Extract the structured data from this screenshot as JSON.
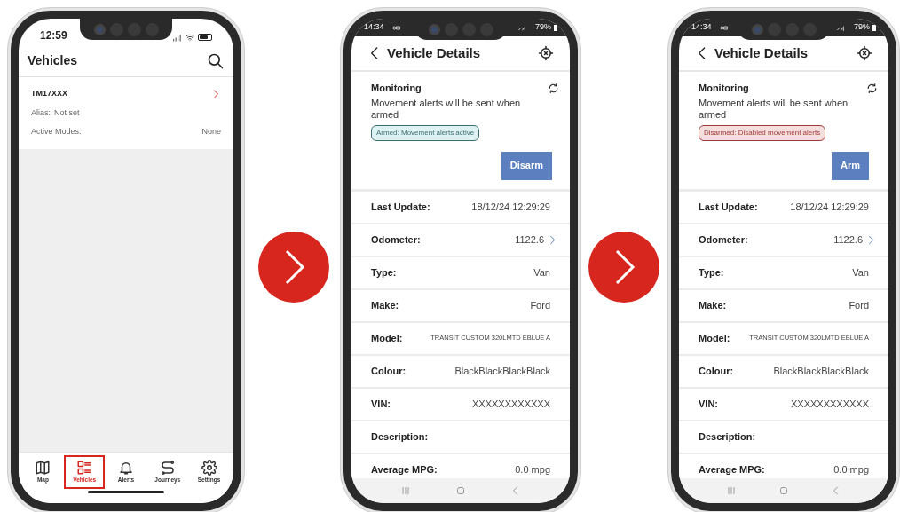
{
  "phones": [
    {
      "kind": "vehicle_list",
      "status_bar": {
        "time": "12:59"
      },
      "title": "Vehicles",
      "vehicles": [
        {
          "registration": "TM17XXX",
          "alias_label": "Alias:",
          "alias": "Not set",
          "modes_label": "Active Modes:",
          "modes": "None"
        }
      ],
      "tab_bar": [
        {
          "kind": "map",
          "label": "Map",
          "selected": false
        },
        {
          "kind": "list",
          "label": "Vehicles",
          "selected": true
        },
        {
          "kind": "bell",
          "label": "Alerts",
          "selected": false
        },
        {
          "kind": "route",
          "label": "Journeys",
          "selected": false
        },
        {
          "kind": "gear",
          "label": "Settings",
          "selected": false
        }
      ]
    },
    {
      "kind": "vehicle_details",
      "status_bar": {
        "time": "14:34",
        "battery": "79%"
      },
      "title": "Vehicle Details",
      "monitoring": {
        "heading": "Monitoring",
        "text": "Movement alerts will be sent when armed",
        "badge": "Armed: Movement alerts active",
        "armed": true,
        "button": "Disarm"
      },
      "fields": [
        {
          "label": "Last Update:",
          "value": "18/12/24 12:29:29",
          "link": false
        },
        {
          "label": "Odometer:",
          "value": "1122.6",
          "link": true
        },
        {
          "label": "Type:",
          "value": "Van",
          "link": false
        },
        {
          "label": "Make:",
          "value": "Ford",
          "link": false
        },
        {
          "label": "Model:",
          "value": "TRANSIT CUSTOM 320LMTD EBLUE A",
          "link": false,
          "small": true
        },
        {
          "label": "Colour:",
          "value": "BlackBlackBlackBlack",
          "link": false
        },
        {
          "label": "VIN:",
          "value": "XXXXXXXXXXXX",
          "link": false
        },
        {
          "label": "Description:",
          "link": false
        },
        {
          "label": "Average MPG:",
          "value": "0.0 mpg",
          "link": false
        }
      ]
    },
    {
      "kind": "vehicle_details",
      "status_bar": {
        "time": "14:34",
        "battery": "79%"
      },
      "title": "Vehicle Details",
      "monitoring": {
        "heading": "Monitoring",
        "text": "Movement alerts will be sent when armed",
        "badge": "Disarmed: Disabled movement alerts",
        "armed": false,
        "button": "Arm"
      },
      "fields": [
        {
          "label": "Last Update:",
          "value": "18/12/24 12:29:29",
          "link": false
        },
        {
          "label": "Odometer:",
          "value": "1122.6",
          "link": true
        },
        {
          "label": "Type:",
          "value": "Van",
          "link": false
        },
        {
          "label": "Make:",
          "value": "Ford",
          "link": false
        },
        {
          "label": "Model:",
          "value": "TRANSIT CUSTOM 320LMTD EBLUE A",
          "link": false,
          "small": true
        },
        {
          "label": "Colour:",
          "value": "BlackBlackBlackBlack",
          "link": false
        },
        {
          "label": "VIN:",
          "value": "XXXXXXXXXXXX",
          "link": false
        },
        {
          "label": "Description:",
          "link": false
        },
        {
          "label": "Average MPG:",
          "value": "0.0 mpg",
          "link": false
        }
      ]
    }
  ]
}
